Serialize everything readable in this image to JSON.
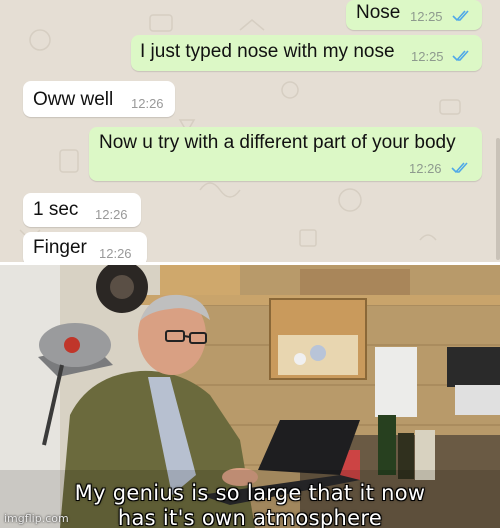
{
  "colors": {
    "chat_background": "#e5ded4",
    "outgoing_bubble": "#dcf8c6",
    "incoming_bubble": "#ffffff",
    "read_ticks": "#4fa8e8"
  },
  "chat": {
    "messages": [
      {
        "direction": "outgoing",
        "text": "Nose",
        "time": "12:25",
        "status": "read",
        "status_icon": "double-check-icon"
      },
      {
        "direction": "outgoing",
        "text": "I just typed nose with my nose",
        "time": "12:25",
        "status": "read",
        "status_icon": "double-check-icon"
      },
      {
        "direction": "incoming",
        "text": "Oww well",
        "time": "12:26"
      },
      {
        "direction": "outgoing",
        "text": "Now u try with a different part of your body",
        "time": "12:26",
        "status": "read",
        "status_icon": "double-check-icon"
      },
      {
        "direction": "incoming",
        "text": "1 sec",
        "time": "12:26"
      },
      {
        "direction": "incoming",
        "text": "Finger",
        "time": "12:26"
      }
    ]
  },
  "meme": {
    "caption_line1": "My genius is so large that it now",
    "caption_line2": "has it's own atmosphere",
    "watermark": "imgflip.com"
  }
}
